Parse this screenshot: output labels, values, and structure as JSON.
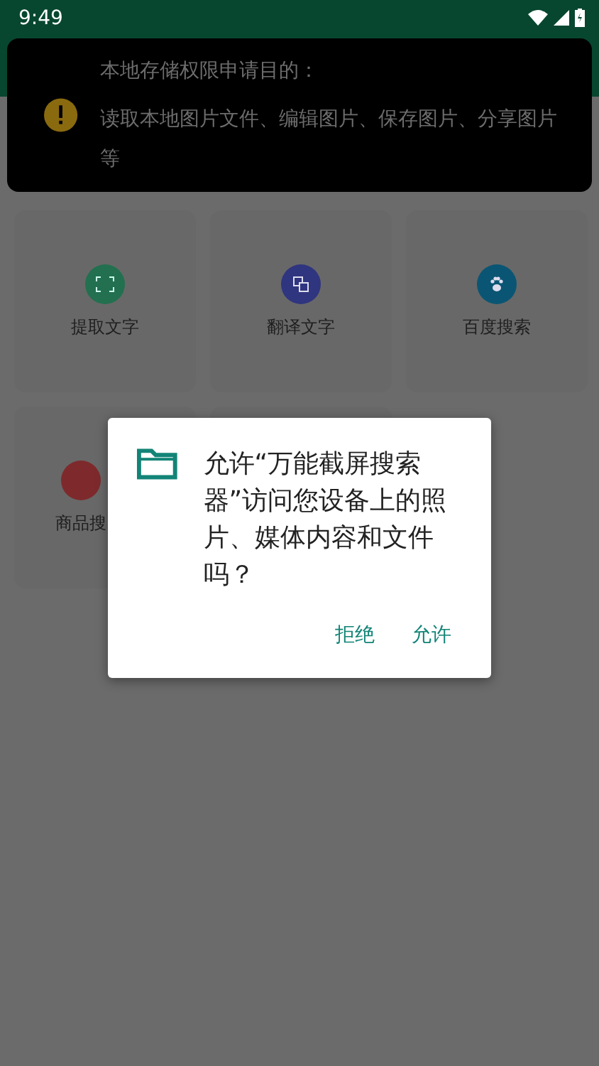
{
  "status_bar": {
    "time": "9:49"
  },
  "notice": {
    "title": "本地存储权限申请目的：",
    "body": "读取本地图片文件、编辑图片、保存图片、分享图片等"
  },
  "tools": [
    {
      "label": "提取文字",
      "color": "#22704f",
      "kind": "ocr"
    },
    {
      "label": "翻译文字",
      "color": "#2f357f",
      "kind": "translate"
    },
    {
      "label": "百度搜索",
      "color": "#0a5574",
      "kind": "paw"
    },
    {
      "label": "商品搜",
      "color": "#7e2a2c",
      "kind": "shop"
    }
  ],
  "dialog": {
    "message": "允许“万能截屏搜索器”访问您设备上的照片、媒体内容和文件吗？",
    "buttons": [
      "拒绝",
      "允许"
    ]
  }
}
